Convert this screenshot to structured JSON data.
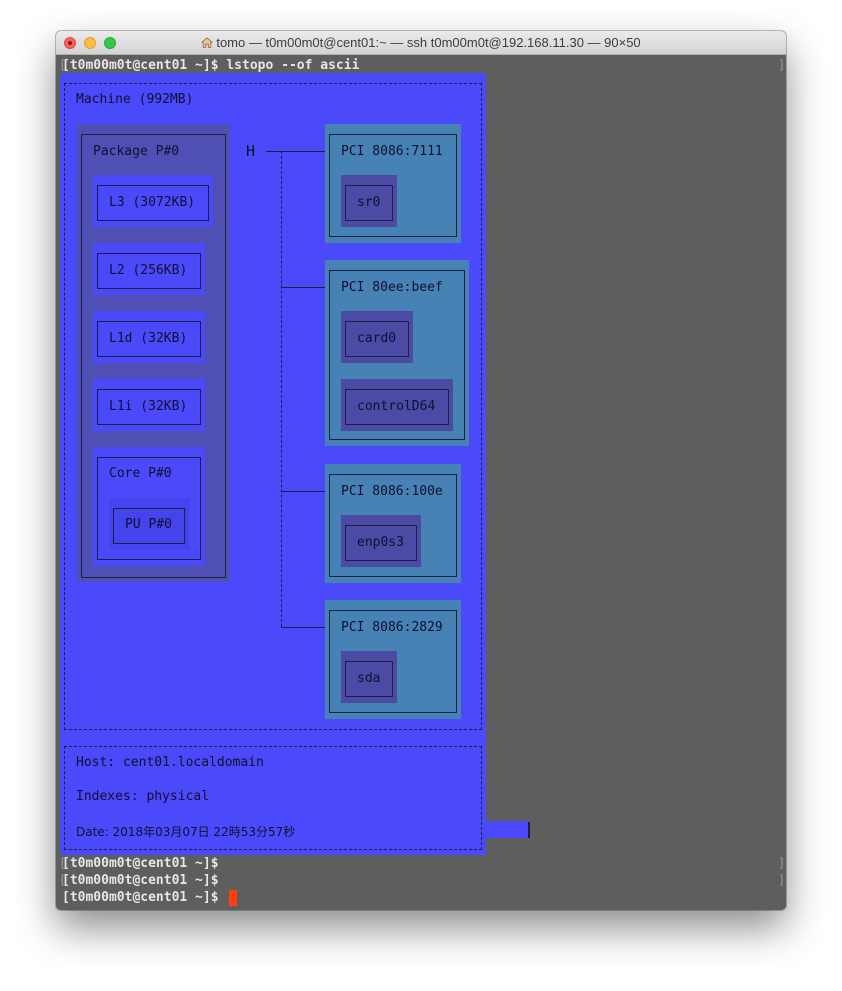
{
  "window": {
    "title": "tomo — t0m00m0t@cent01:~ — ssh t0m00m0t@192.168.11.30 — 90×50"
  },
  "terminal": {
    "command_line": "[t0m00m0t@cent01 ~]$ lstopo --of ascii",
    "prompt_lines": [
      "[t0m00m0t@cent01 ~]$",
      "[t0m00m0t@cent01 ~]$",
      "[t0m00m0t@cent01 ~]$"
    ]
  },
  "topology": {
    "machine": "Machine (992MB)",
    "package": "Package P#0",
    "caches": [
      "L3 (3072KB)",
      "L2 (256KB)",
      "L1d (32KB)",
      "L1i (32KB)"
    ],
    "core": "Core P#0",
    "pu": "PU P#0",
    "host_bridge": "H",
    "pci": [
      {
        "name": "PCI 8086:7111",
        "devices": [
          "sr0"
        ]
      },
      {
        "name": "PCI 80ee:beef",
        "devices": [
          "card0",
          "controlD64"
        ]
      },
      {
        "name": "PCI 8086:100e",
        "devices": [
          "enp0s3"
        ]
      },
      {
        "name": "PCI 8086:2829",
        "devices": [
          "sda"
        ]
      }
    ]
  },
  "info": {
    "host": "Host: cent01.localdomain",
    "indexes": "Indexes: physical",
    "date": "Date: 2018年03月07日 22時53分57秒"
  },
  "colors": {
    "machine_bg": "#4a4afa",
    "package_bg": "#4f4fb4",
    "pci_bg": "#4682b4",
    "osdev_bg": "#4b4ba6",
    "terminal_bg": "#5e5e5e",
    "cursor": "#ff3d12"
  },
  "icons": {
    "title_icon": "home-icon"
  }
}
